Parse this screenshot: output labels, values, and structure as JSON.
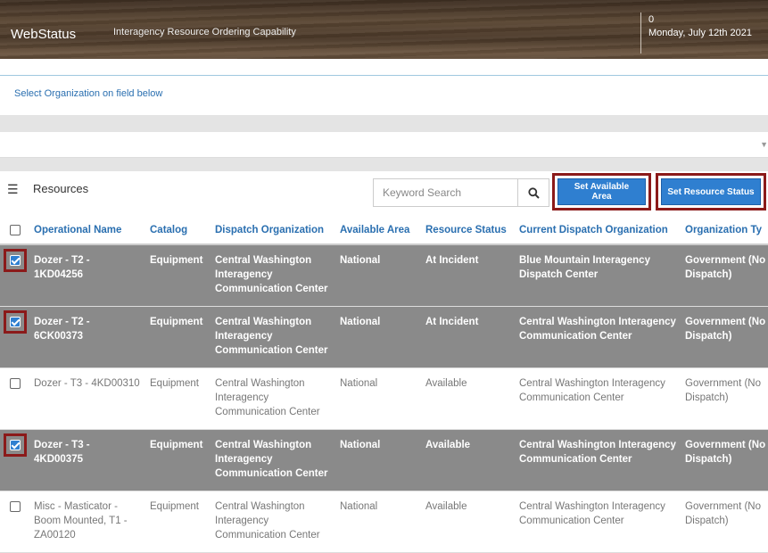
{
  "header": {
    "app_title": "WebStatus",
    "app_subtitle": "Interagency Resource Ordering Capability",
    "count": "0",
    "date": "Monday, July 12th 2021"
  },
  "organization": {
    "label": "Select Organization on field below",
    "selected": ""
  },
  "toolbar": {
    "title": "Resources",
    "search_placeholder": "Keyword Search",
    "set_available_area": "Set Available Area",
    "set_resource_status": "Set Resource Status"
  },
  "table": {
    "columns": [
      "Operational Name",
      "Catalog",
      "Dispatch Organization",
      "Available Area",
      "Resource Status",
      "Current Dispatch Organization",
      "Organization Ty"
    ],
    "rows": [
      {
        "checked": true,
        "highlighted": true,
        "name": "Dozer - T2 - 1KD04256",
        "catalog": "Equipment",
        "dispatch_org": "Central Washington Interagency Communication Center",
        "area": "National",
        "status": "At Incident",
        "current_org": "Blue Mountain Interagency Dispatch Center",
        "org_type": "Government (No Dispatch)"
      },
      {
        "checked": true,
        "highlighted": true,
        "name": "Dozer - T2 - 6CK00373",
        "catalog": "Equipment",
        "dispatch_org": "Central Washington Interagency Communication Center",
        "area": "National",
        "status": "At Incident",
        "current_org": "Central Washington Interagency Communication Center",
        "org_type": "Government (No Dispatch)"
      },
      {
        "checked": false,
        "highlighted": false,
        "name": "Dozer - T3 - 4KD00310",
        "catalog": "Equipment",
        "dispatch_org": "Central Washington Interagency Communication Center",
        "area": "National",
        "status": "Available",
        "current_org": "Central Washington Interagency Communication Center",
        "org_type": "Government (No Dispatch)"
      },
      {
        "checked": true,
        "highlighted": true,
        "name": "Dozer - T3 - 4KD00375",
        "catalog": "Equipment",
        "dispatch_org": "Central Washington Interagency Communication Center",
        "area": "National",
        "status": "Available",
        "current_org": "Central Washington Interagency Communication Center",
        "org_type": "Government (No Dispatch)"
      },
      {
        "checked": false,
        "highlighted": false,
        "name": "Misc - Masticator - Boom Mounted, T1 - ZA00120",
        "catalog": "Equipment",
        "dispatch_org": "Central Washington Interagency Communication Center",
        "area": "National",
        "status": "Available",
        "current_org": "Central Washington Interagency Communication Center",
        "org_type": "Government (No Dispatch)"
      }
    ]
  },
  "colors": {
    "accent": "#2f7fd0",
    "link_text": "#2a6fb0",
    "selected_row": "#8a8a8a",
    "highlight_border": "#8b1a1a"
  }
}
